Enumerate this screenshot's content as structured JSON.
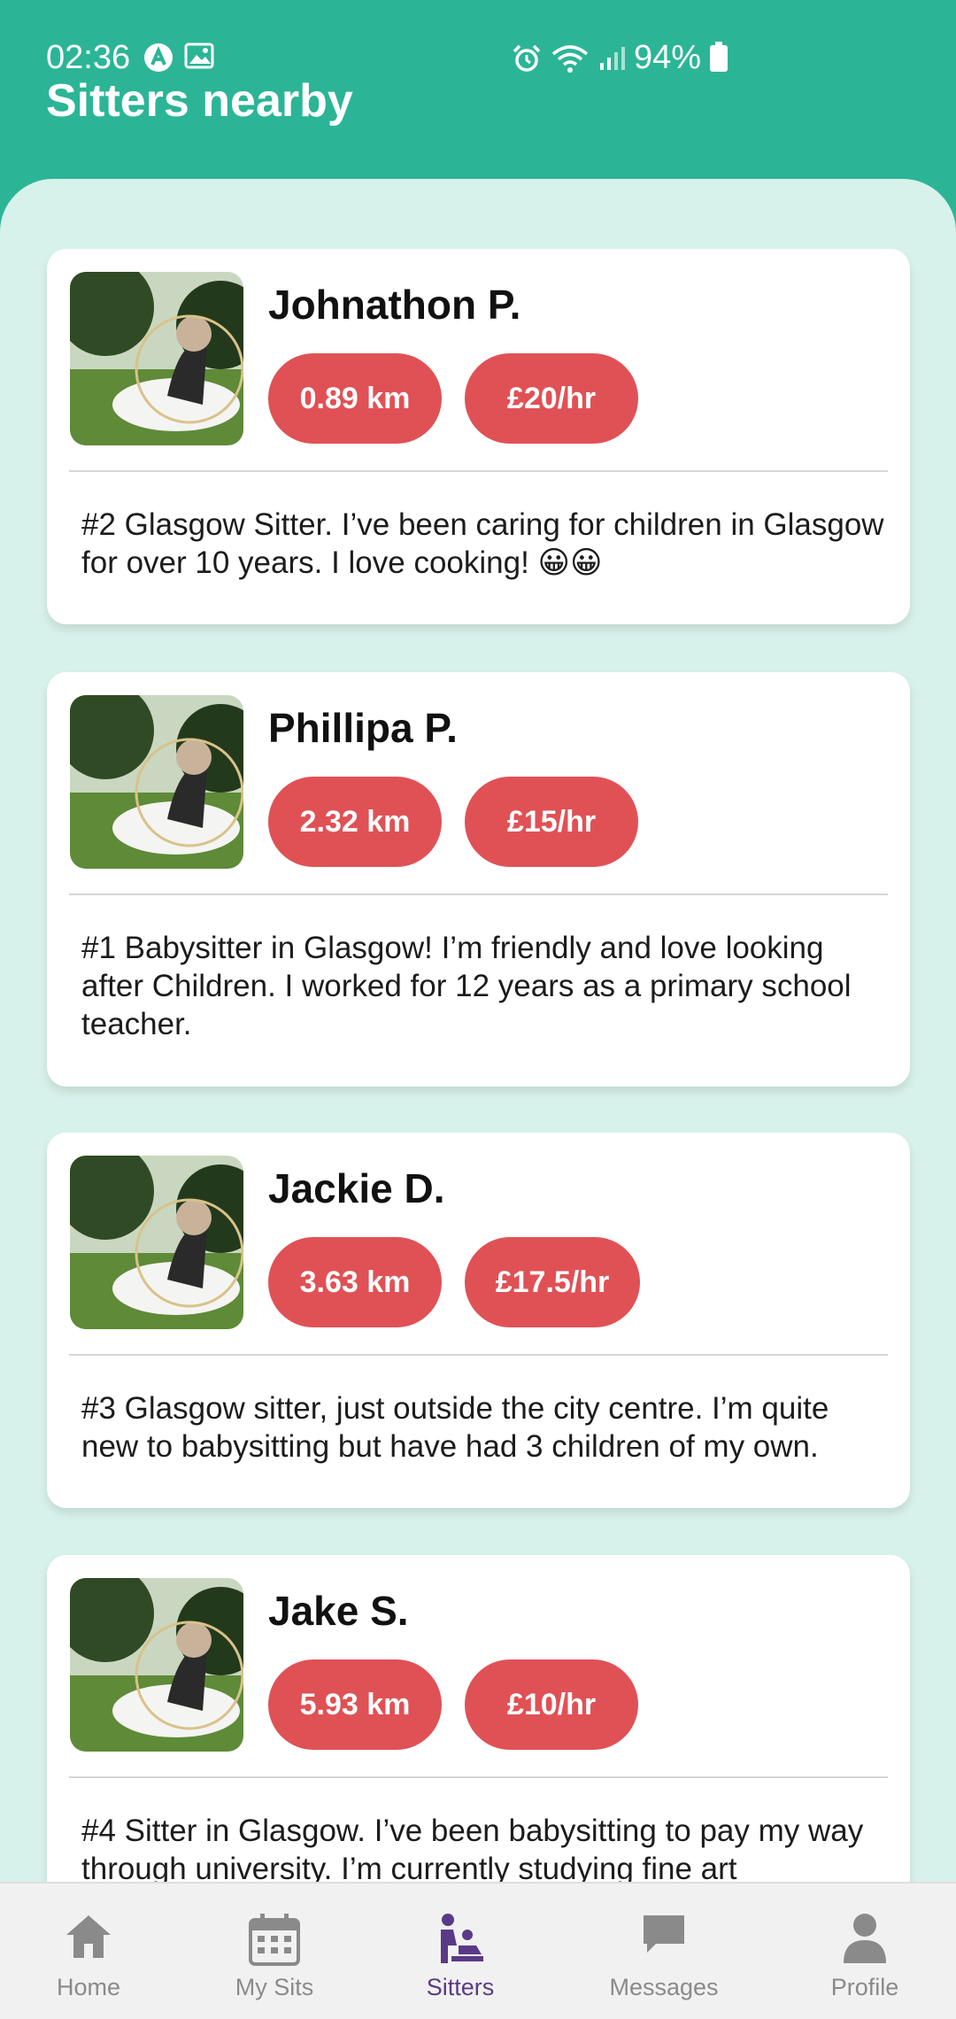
{
  "status": {
    "time": "02:36",
    "battery": "94%"
  },
  "header": {
    "title": "Sitters nearby"
  },
  "sitters": [
    {
      "name": "Johnathon P.",
      "distance": "0.89 km",
      "rate": "£20/hr",
      "bio": "#2 Glasgow Sitter. I’ve been caring for children in Glasgow for over 10 years. I love cooking! 😀😀"
    },
    {
      "name": "Phillipa P.",
      "distance": "2.32 km",
      "rate": "£15/hr",
      "bio": "#1 Babysitter in Glasgow! I’m friendly and love looking after Children. I worked for 12 years as a primary school teacher."
    },
    {
      "name": "Jackie D.",
      "distance": "3.63 km",
      "rate": "£17.5/hr",
      "bio": "#3 Glasgow sitter, just outside the city centre. I’m quite new to babysitting but have had 3 children of my own."
    },
    {
      "name": "Jake S.",
      "distance": "5.93 km",
      "rate": "£10/hr",
      "bio": "#4 Sitter in Glasgow. I’ve been babysitting to pay my way through university. I’m currently studying fine art"
    }
  ],
  "nav": [
    {
      "label": "Home",
      "icon": "home-icon"
    },
    {
      "label": "My Sits",
      "icon": "calendar-icon"
    },
    {
      "label": "Sitters",
      "icon": "babysitter-icon"
    },
    {
      "label": "Messages",
      "icon": "chat-icon"
    },
    {
      "label": "Profile",
      "icon": "person-icon"
    }
  ],
  "colors": {
    "header": "#2bb596",
    "content_bg": "#d7f2ea",
    "pill": "#e05155",
    "nav_active": "#5a3a86",
    "nav_inactive": "#8a8a8a"
  }
}
